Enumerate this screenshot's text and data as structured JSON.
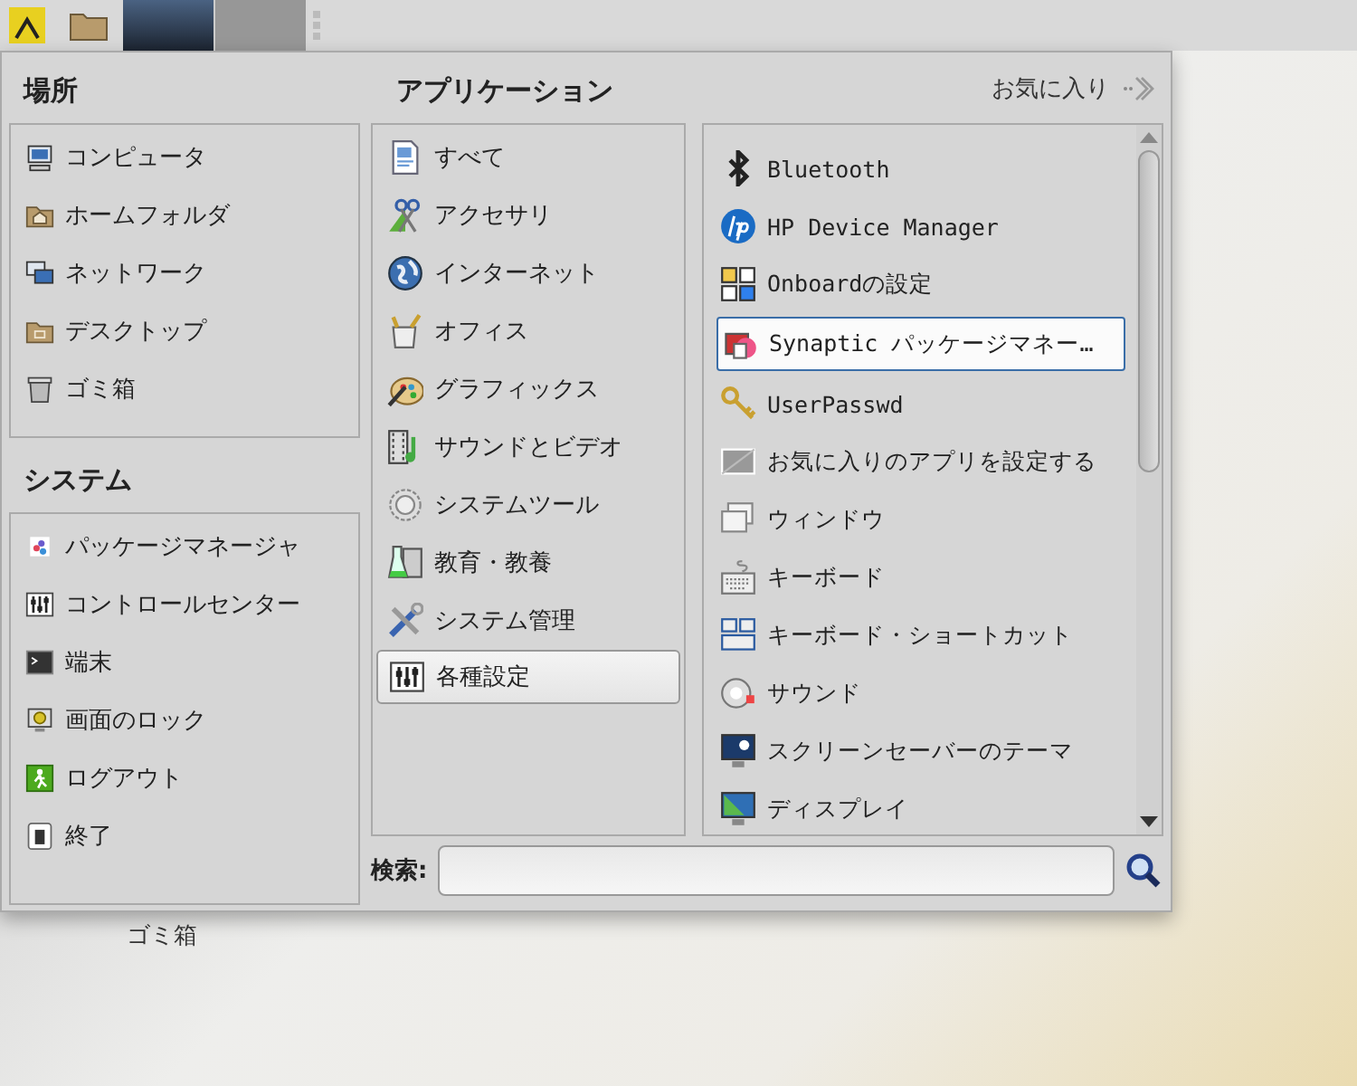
{
  "taskbar": {
    "window_buttons": [
      {
        "kind": "dark"
      },
      {
        "kind": "grey"
      }
    ]
  },
  "places": {
    "title": "場所",
    "items": [
      {
        "label": "コンピュータ"
      },
      {
        "label": "ホームフォルダ"
      },
      {
        "label": "ネットワーク"
      },
      {
        "label": "デスクトップ"
      },
      {
        "label": "ゴミ箱"
      }
    ]
  },
  "system": {
    "title": "システム",
    "items": [
      {
        "label": "パッケージマネージャ"
      },
      {
        "label": "コントロールセンター"
      },
      {
        "label": "端末"
      },
      {
        "label": "画面のロック"
      },
      {
        "label": "ログアウト"
      },
      {
        "label": "終了"
      }
    ]
  },
  "applications": {
    "title": "アプリケーション",
    "favorites_link": "お気に入り",
    "categories": [
      {
        "label": "すべて",
        "selected": false
      },
      {
        "label": "アクセサリ",
        "selected": false
      },
      {
        "label": "インターネット",
        "selected": false
      },
      {
        "label": "オフィス",
        "selected": false
      },
      {
        "label": "グラフィックス",
        "selected": false
      },
      {
        "label": "サウンドとビデオ",
        "selected": false
      },
      {
        "label": "システムツール",
        "selected": false
      },
      {
        "label": "教育・教養",
        "selected": false
      },
      {
        "label": "システム管理",
        "selected": false
      },
      {
        "label": "各種設定",
        "selected": true
      }
    ],
    "apps": [
      {
        "label": "Bluetooth",
        "selected": false
      },
      {
        "label": "HP Device Manager",
        "selected": false
      },
      {
        "label": "Onboardの設定",
        "selected": false
      },
      {
        "label": "Synaptic パッケージマネー…",
        "selected": true
      },
      {
        "label": "UserPasswd",
        "selected": false
      },
      {
        "label": "お気に入りのアプリを設定する",
        "selected": false
      },
      {
        "label": "ウィンドウ",
        "selected": false
      },
      {
        "label": "キーボード",
        "selected": false
      },
      {
        "label": "キーボード・ショートカット",
        "selected": false
      },
      {
        "label": "サウンド",
        "selected": false
      },
      {
        "label": "スクリーンセーバーのテーマ",
        "selected": false
      },
      {
        "label": "ディスプレイ",
        "selected": false
      }
    ]
  },
  "search": {
    "label": "検索:"
  },
  "desktop": {
    "icon_label": "ゴミ箱"
  }
}
